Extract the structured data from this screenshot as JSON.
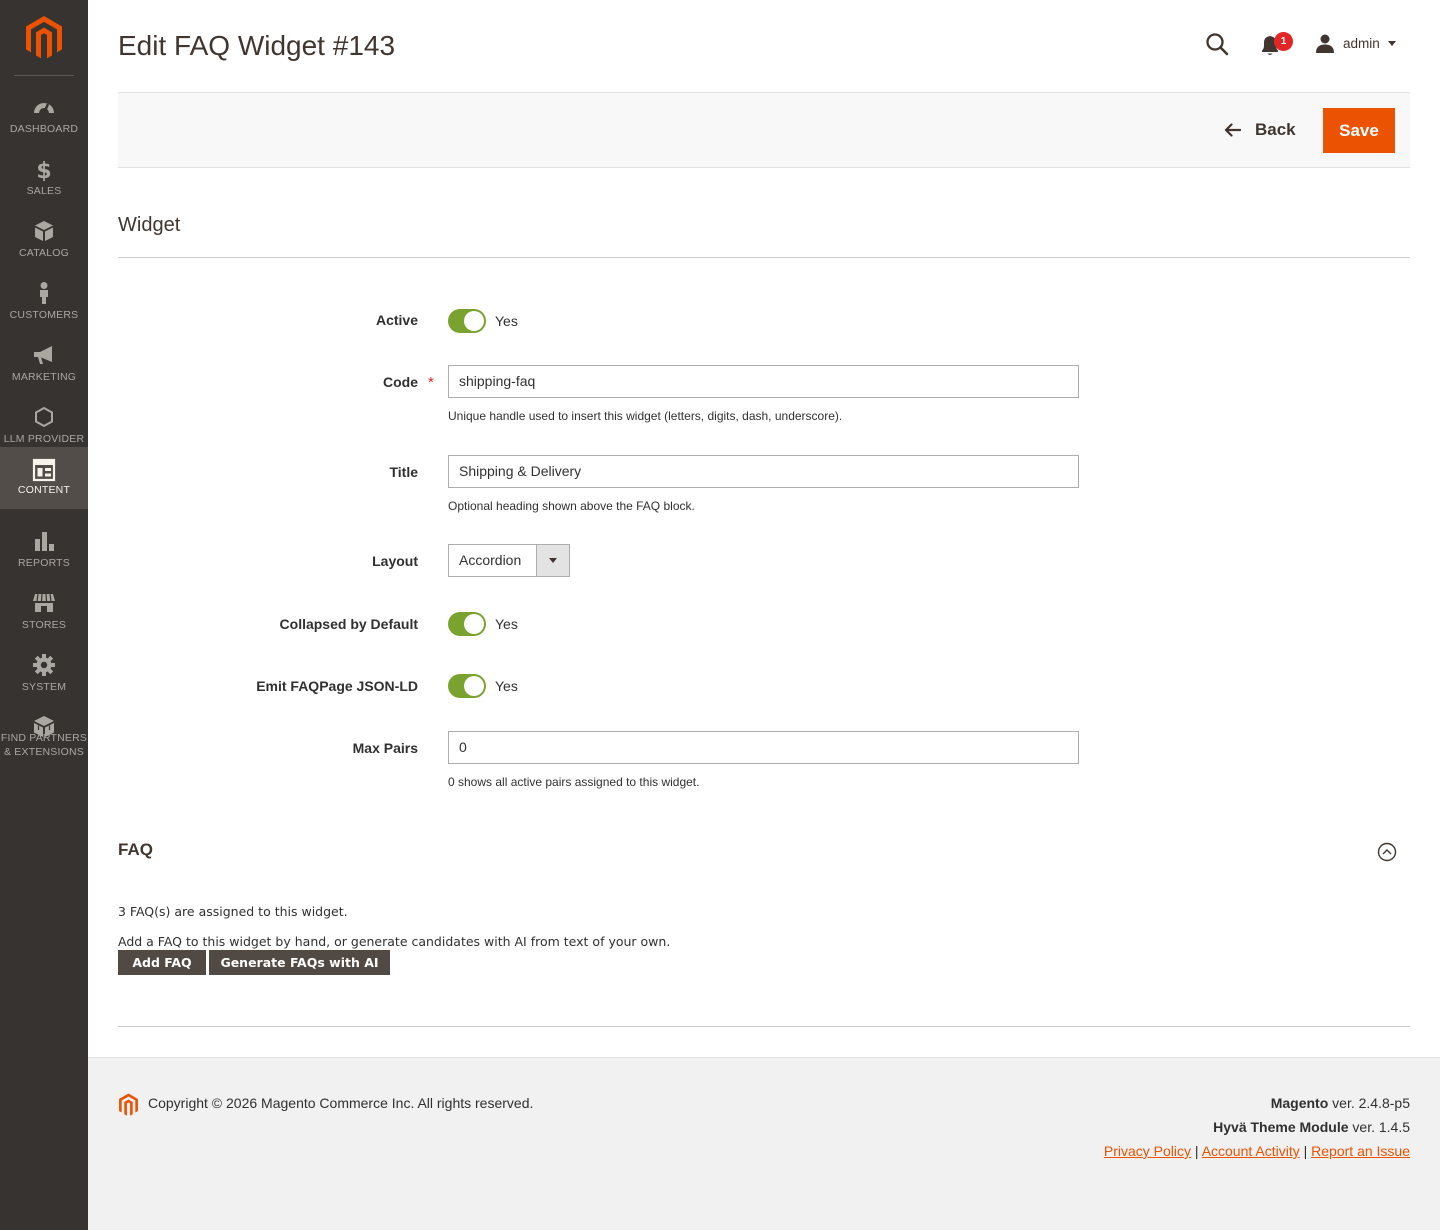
{
  "sidebar": {
    "items": [
      {
        "label": "Dashboard",
        "icon": "dashboard-icon"
      },
      {
        "label": "Sales",
        "icon": "dollar-icon"
      },
      {
        "label": "Catalog",
        "icon": "box-icon"
      },
      {
        "label": "Customers",
        "icon": "person-icon"
      },
      {
        "label": "Marketing",
        "icon": "megaphone-icon"
      },
      {
        "label": "LLM Provider",
        "icon": "hexagon-icon"
      },
      {
        "label": "Content",
        "icon": "layout-icon",
        "active": true
      },
      {
        "label": "Reports",
        "icon": "bar-chart-icon"
      },
      {
        "label": "Stores",
        "icon": "store-icon"
      },
      {
        "label": "System",
        "icon": "gear-icon"
      },
      {
        "label": "Find Partners",
        "label2": "& Extensions",
        "icon": "cubes-icon"
      }
    ]
  },
  "header": {
    "title": "Edit FAQ Widget #143",
    "notification_count": "1",
    "user_name": "admin"
  },
  "actions": {
    "back_label": "Back",
    "save_label": "Save"
  },
  "widget": {
    "section_title": "Widget",
    "active": {
      "label": "Active",
      "value": "Yes"
    },
    "code": {
      "label": "Code",
      "required_mark": "*",
      "value": "shipping-faq",
      "note": "Unique handle used to insert this widget (letters, digits, dash, underscore)."
    },
    "title": {
      "label": "Title",
      "value": "Shipping & Delivery",
      "note": "Optional heading shown above the FAQ block."
    },
    "layout": {
      "label": "Layout",
      "value": "Accordion"
    },
    "collapsed": {
      "label": "Collapsed by Default",
      "value": "Yes"
    },
    "emit_jsonld": {
      "label": "Emit FAQPage JSON-LD",
      "value": "Yes"
    },
    "max_pairs": {
      "label": "Max Pairs",
      "value": "0",
      "note": "0 shows all active pairs assigned to this widget."
    }
  },
  "faq": {
    "title": "FAQ",
    "count_text": "3 FAQ(s) are assigned to this widget.",
    "help_text": "Add a FAQ to this widget by hand, or generate candidates with AI from text of your own.",
    "add_label": "Add FAQ",
    "generate_label": "Generate FAQs with AI"
  },
  "footer": {
    "copyright": "Copyright © 2026 Magento Commerce Inc. All rights reserved.",
    "magento_name": "Magento",
    "magento_version": " ver. 2.4.8-p5",
    "hyva_name": "Hyvä Theme Module",
    "hyva_version": " ver. 1.4.5",
    "links": [
      "Privacy Policy",
      " Account Activity",
      "Report an Issue"
    ],
    "separator": " | "
  },
  "colors": {
    "sidebar_bg": "#373330",
    "accent": "#eb5202",
    "toggle_on": "#79a22e",
    "dark_button": "#514943"
  }
}
